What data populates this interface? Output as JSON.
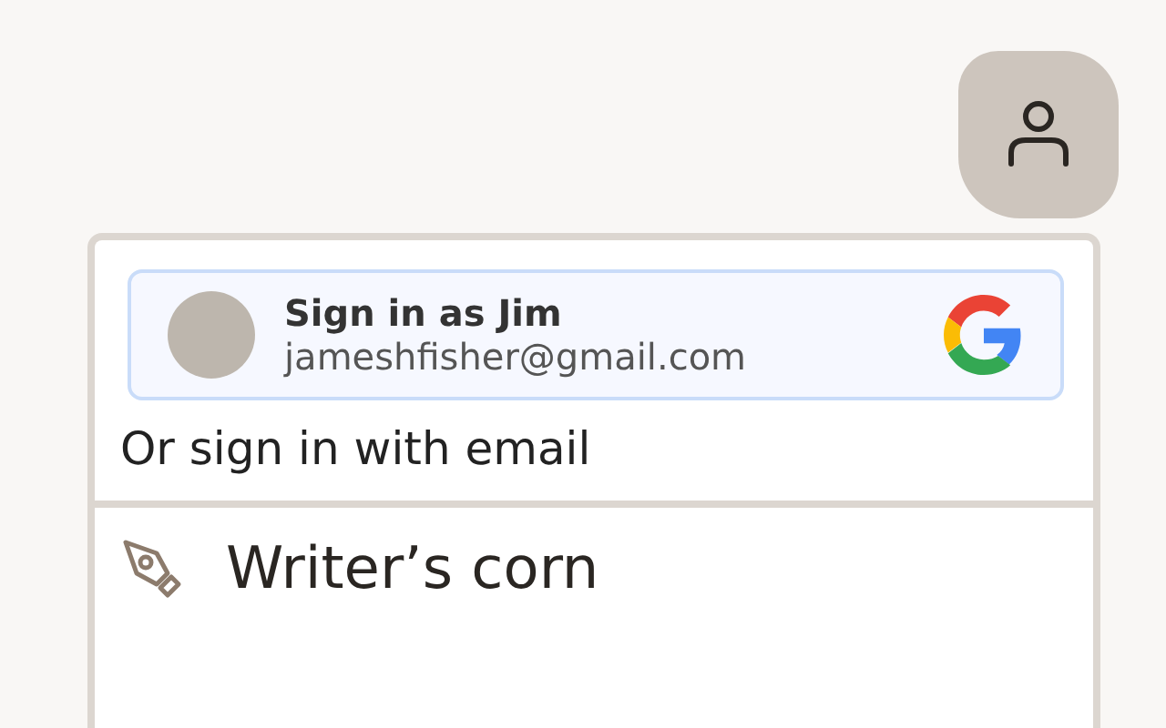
{
  "google_signin": {
    "title": "Sign in as Jim",
    "email": "jameshfisher@gmail.com"
  },
  "email_option": {
    "label": "Or sign in with email"
  },
  "menu_items": [
    {
      "label": "Writer’s corn"
    }
  ]
}
